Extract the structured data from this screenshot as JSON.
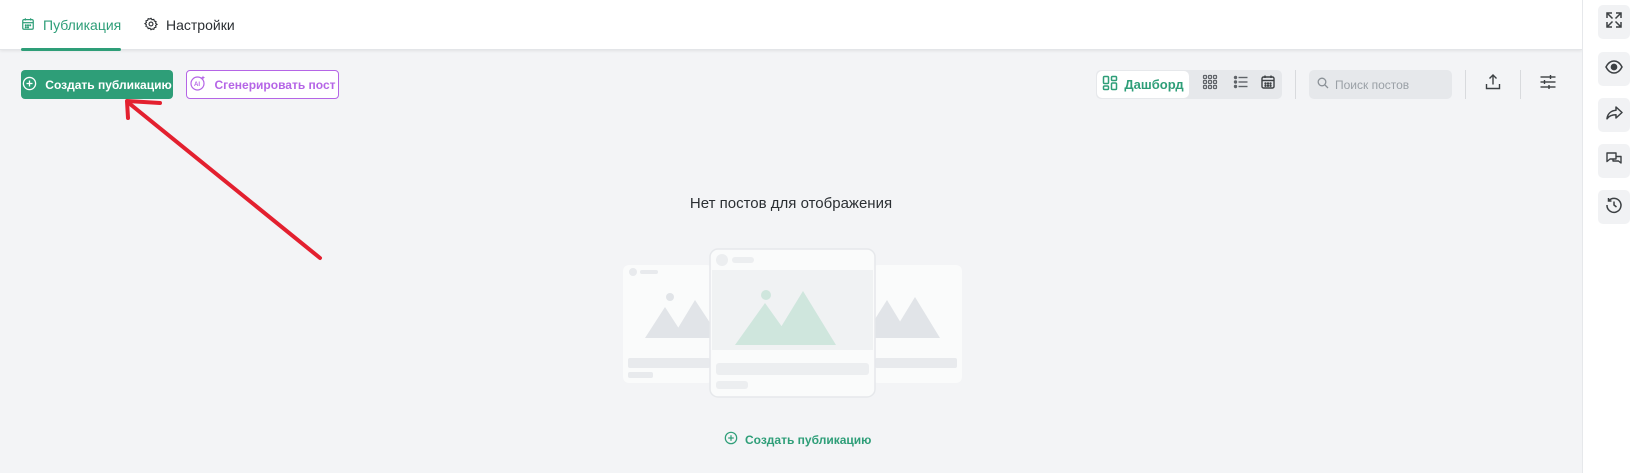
{
  "tabs": [
    {
      "label": "Публикация",
      "icon": "calendar-icon",
      "active": true
    },
    {
      "label": "Настройки",
      "icon": "gear-icon",
      "active": false
    }
  ],
  "toolbar": {
    "create_label": "Создать публикацию",
    "generate_label": "Сгенерировать пост",
    "view_dashboard_label": "Дашборд",
    "views": [
      "dashboard",
      "grid",
      "list",
      "calendar"
    ],
    "search_placeholder": "Поиск постов",
    "upload_icon": "upload-icon",
    "filter_icon": "sliders-icon"
  },
  "empty_state": {
    "title": "Нет постов для отображения",
    "create_label": "Создать публикацию"
  },
  "right_rail": [
    "expand-icon",
    "eye-icon",
    "share-icon",
    "chat-icon",
    "history-icon"
  ],
  "colors": {
    "accent": "#2e9e78",
    "ai_accent": "#b565e6",
    "annotation_arrow": "#e3202f",
    "background": "#f3f4f6"
  }
}
